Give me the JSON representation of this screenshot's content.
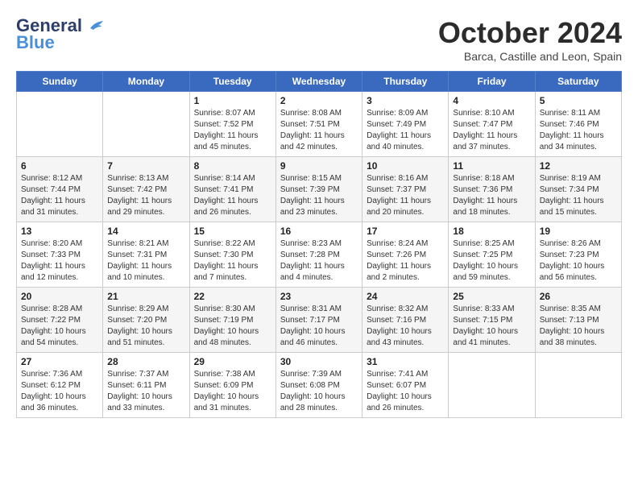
{
  "header": {
    "logo_line1": "General",
    "logo_line2": "Blue",
    "month": "October 2024",
    "location": "Barca, Castille and Leon, Spain"
  },
  "weekdays": [
    "Sunday",
    "Monday",
    "Tuesday",
    "Wednesday",
    "Thursday",
    "Friday",
    "Saturday"
  ],
  "weeks": [
    [
      {
        "day": "",
        "info": ""
      },
      {
        "day": "",
        "info": ""
      },
      {
        "day": "1",
        "info": "Sunrise: 8:07 AM\nSunset: 7:52 PM\nDaylight: 11 hours and 45 minutes."
      },
      {
        "day": "2",
        "info": "Sunrise: 8:08 AM\nSunset: 7:51 PM\nDaylight: 11 hours and 42 minutes."
      },
      {
        "day": "3",
        "info": "Sunrise: 8:09 AM\nSunset: 7:49 PM\nDaylight: 11 hours and 40 minutes."
      },
      {
        "day": "4",
        "info": "Sunrise: 8:10 AM\nSunset: 7:47 PM\nDaylight: 11 hours and 37 minutes."
      },
      {
        "day": "5",
        "info": "Sunrise: 8:11 AM\nSunset: 7:46 PM\nDaylight: 11 hours and 34 minutes."
      }
    ],
    [
      {
        "day": "6",
        "info": "Sunrise: 8:12 AM\nSunset: 7:44 PM\nDaylight: 11 hours and 31 minutes."
      },
      {
        "day": "7",
        "info": "Sunrise: 8:13 AM\nSunset: 7:42 PM\nDaylight: 11 hours and 29 minutes."
      },
      {
        "day": "8",
        "info": "Sunrise: 8:14 AM\nSunset: 7:41 PM\nDaylight: 11 hours and 26 minutes."
      },
      {
        "day": "9",
        "info": "Sunrise: 8:15 AM\nSunset: 7:39 PM\nDaylight: 11 hours and 23 minutes."
      },
      {
        "day": "10",
        "info": "Sunrise: 8:16 AM\nSunset: 7:37 PM\nDaylight: 11 hours and 20 minutes."
      },
      {
        "day": "11",
        "info": "Sunrise: 8:18 AM\nSunset: 7:36 PM\nDaylight: 11 hours and 18 minutes."
      },
      {
        "day": "12",
        "info": "Sunrise: 8:19 AM\nSunset: 7:34 PM\nDaylight: 11 hours and 15 minutes."
      }
    ],
    [
      {
        "day": "13",
        "info": "Sunrise: 8:20 AM\nSunset: 7:33 PM\nDaylight: 11 hours and 12 minutes."
      },
      {
        "day": "14",
        "info": "Sunrise: 8:21 AM\nSunset: 7:31 PM\nDaylight: 11 hours and 10 minutes."
      },
      {
        "day": "15",
        "info": "Sunrise: 8:22 AM\nSunset: 7:30 PM\nDaylight: 11 hours and 7 minutes."
      },
      {
        "day": "16",
        "info": "Sunrise: 8:23 AM\nSunset: 7:28 PM\nDaylight: 11 hours and 4 minutes."
      },
      {
        "day": "17",
        "info": "Sunrise: 8:24 AM\nSunset: 7:26 PM\nDaylight: 11 hours and 2 minutes."
      },
      {
        "day": "18",
        "info": "Sunrise: 8:25 AM\nSunset: 7:25 PM\nDaylight: 10 hours and 59 minutes."
      },
      {
        "day": "19",
        "info": "Sunrise: 8:26 AM\nSunset: 7:23 PM\nDaylight: 10 hours and 56 minutes."
      }
    ],
    [
      {
        "day": "20",
        "info": "Sunrise: 8:28 AM\nSunset: 7:22 PM\nDaylight: 10 hours and 54 minutes."
      },
      {
        "day": "21",
        "info": "Sunrise: 8:29 AM\nSunset: 7:20 PM\nDaylight: 10 hours and 51 minutes."
      },
      {
        "day": "22",
        "info": "Sunrise: 8:30 AM\nSunset: 7:19 PM\nDaylight: 10 hours and 48 minutes."
      },
      {
        "day": "23",
        "info": "Sunrise: 8:31 AM\nSunset: 7:17 PM\nDaylight: 10 hours and 46 minutes."
      },
      {
        "day": "24",
        "info": "Sunrise: 8:32 AM\nSunset: 7:16 PM\nDaylight: 10 hours and 43 minutes."
      },
      {
        "day": "25",
        "info": "Sunrise: 8:33 AM\nSunset: 7:15 PM\nDaylight: 10 hours and 41 minutes."
      },
      {
        "day": "26",
        "info": "Sunrise: 8:35 AM\nSunset: 7:13 PM\nDaylight: 10 hours and 38 minutes."
      }
    ],
    [
      {
        "day": "27",
        "info": "Sunrise: 7:36 AM\nSunset: 6:12 PM\nDaylight: 10 hours and 36 minutes."
      },
      {
        "day": "28",
        "info": "Sunrise: 7:37 AM\nSunset: 6:11 PM\nDaylight: 10 hours and 33 minutes."
      },
      {
        "day": "29",
        "info": "Sunrise: 7:38 AM\nSunset: 6:09 PM\nDaylight: 10 hours and 31 minutes."
      },
      {
        "day": "30",
        "info": "Sunrise: 7:39 AM\nSunset: 6:08 PM\nDaylight: 10 hours and 28 minutes."
      },
      {
        "day": "31",
        "info": "Sunrise: 7:41 AM\nSunset: 6:07 PM\nDaylight: 10 hours and 26 minutes."
      },
      {
        "day": "",
        "info": ""
      },
      {
        "day": "",
        "info": ""
      }
    ]
  ]
}
